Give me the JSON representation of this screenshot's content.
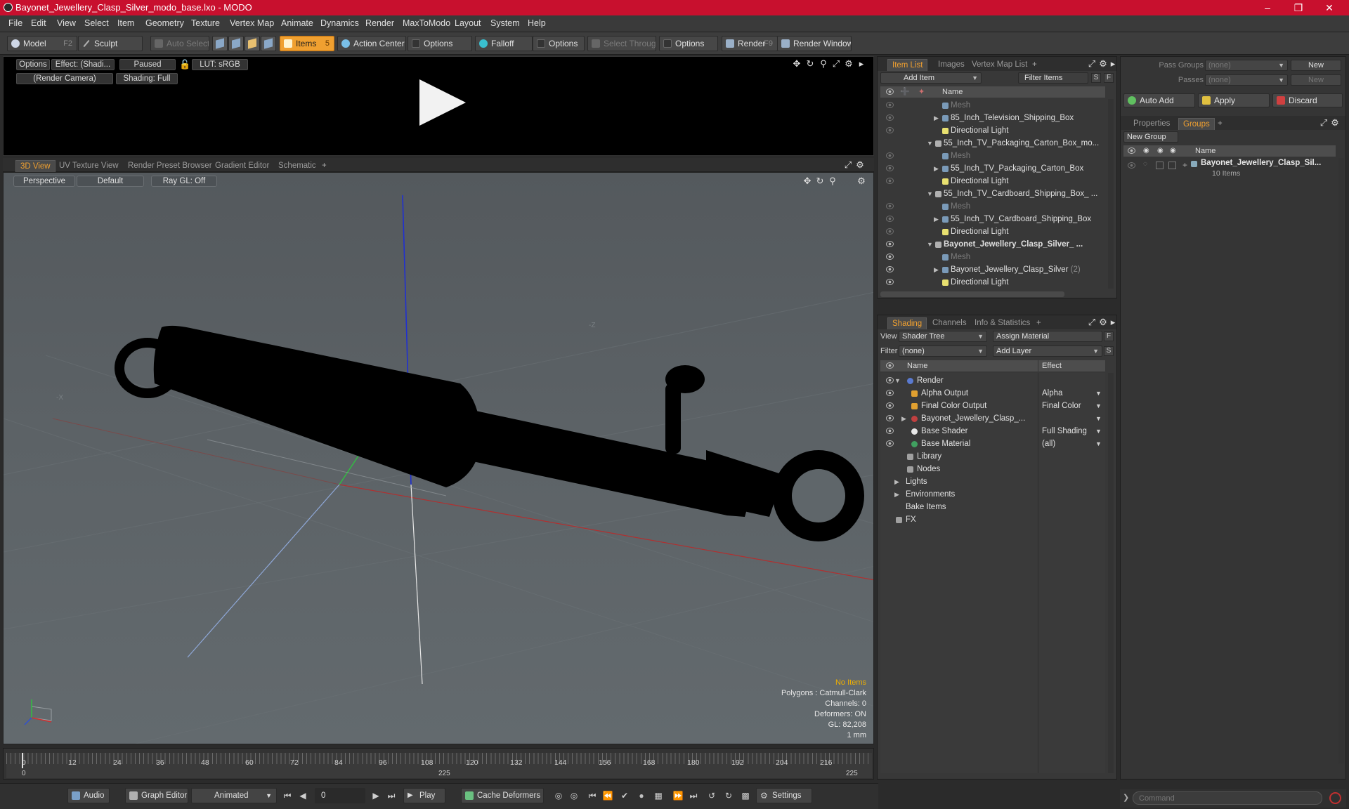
{
  "window": {
    "title": "Bayonet_Jewellery_Clasp_Silver_modo_base.lxo - MODO"
  },
  "menu": [
    "File",
    "Edit",
    "View",
    "Select",
    "Item",
    "Geometry",
    "Texture",
    "Vertex Map",
    "Animate",
    "Dynamics",
    "Render",
    "MaxToModo",
    "Layout",
    "System",
    "Help"
  ],
  "toolbar": {
    "model": "Model",
    "model_key": "F2",
    "sculpt": "Sculpt",
    "auto_select": "Auto Select",
    "items": "Items",
    "items_key": "5",
    "action_center": "Action Center",
    "options1": "Options",
    "falloff": "Falloff",
    "options2": "Options",
    "select_through": "Select Through",
    "options3": "Options",
    "render": "Render",
    "render_key": "F9",
    "render_window": "Render Window"
  },
  "preview": {
    "options": "Options",
    "effect": "Effect: (Shadi...",
    "paused": "Paused",
    "lut": "LUT: sRGB",
    "camera": "(Render Camera)",
    "shading": "Shading: Full"
  },
  "viewport_tabs": [
    "3D View",
    "UV Texture View",
    "Render Preset Browser",
    "Gradient Editor",
    "Schematic"
  ],
  "viewport": {
    "perspective": "Perspective",
    "default": "Default",
    "raygl": "Ray GL: Off",
    "info": {
      "no_items": "No Items",
      "polygons": "Polygons : Catmull-Clark",
      "channels": "Channels: 0",
      "deformers": "Deformers: ON",
      "gl": "GL: 82,208",
      "unit": "1 mm"
    }
  },
  "timeline": {
    "ticks": [
      "0",
      "12",
      "24",
      "36",
      "48",
      "60",
      "72",
      "84",
      "96",
      "108",
      "120",
      "132",
      "144",
      "156",
      "168",
      "180",
      "192",
      "204",
      "216"
    ],
    "lower": [
      "0",
      "225",
      "225"
    ]
  },
  "bottombar": {
    "audio": "Audio",
    "graph_editor": "Graph Editor",
    "animated": "Animated",
    "frame": "0",
    "play": "Play",
    "cache_deformers": "Cache Deformers",
    "settings": "Settings"
  },
  "item_list": {
    "tabs": [
      "Item List",
      "Images",
      "Vertex Map List"
    ],
    "add_item": "Add Item",
    "filter_items": "Filter Items",
    "col_name": "Name",
    "rows": [
      {
        "label": "Mesh",
        "kind": "mesh",
        "indent": 2,
        "expander": "",
        "eye": "dim"
      },
      {
        "label": "85_Inch_Television_Shipping_Box",
        "kind": "mesh",
        "indent": 2,
        "expander": "▶",
        "eye": "dim"
      },
      {
        "label": "Directional Light",
        "kind": "light",
        "indent": 2,
        "expander": "",
        "eye": "dim"
      },
      {
        "label": "55_Inch_TV_Packaging_Carton_Box_mo...",
        "kind": "scene",
        "indent": 1,
        "expander": "▼",
        "eye": "none"
      },
      {
        "label": "Mesh",
        "kind": "mesh",
        "indent": 2,
        "expander": "",
        "eye": "dim"
      },
      {
        "label": "55_Inch_TV_Packaging_Carton_Box",
        "kind": "mesh",
        "indent": 2,
        "expander": "▶",
        "eye": "dim"
      },
      {
        "label": "Directional Light",
        "kind": "light",
        "indent": 2,
        "expander": "",
        "eye": "dim"
      },
      {
        "label": "55_Inch_TV_Cardboard_Shipping_Box_ ...",
        "kind": "scene",
        "indent": 1,
        "expander": "▼",
        "eye": "none"
      },
      {
        "label": "Mesh",
        "kind": "mesh",
        "indent": 2,
        "expander": "",
        "eye": "dim"
      },
      {
        "label": "55_Inch_TV_Cardboard_Shipping_Box",
        "kind": "mesh",
        "indent": 2,
        "expander": "▶",
        "eye": "dim"
      },
      {
        "label": "Directional Light",
        "kind": "light",
        "indent": 2,
        "expander": "",
        "eye": "dim"
      },
      {
        "label": "Bayonet_Jewellery_Clasp_Silver_ ...",
        "kind": "scene",
        "indent": 1,
        "expander": "▼",
        "eye": "on",
        "bold": true
      },
      {
        "label": "Mesh",
        "kind": "mesh",
        "indent": 2,
        "expander": "",
        "eye": "on"
      },
      {
        "label": "Bayonet_Jewellery_Clasp_Silver",
        "suffix": "(2)",
        "kind": "mesh",
        "indent": 2,
        "expander": "▶",
        "eye": "on"
      },
      {
        "label": "Directional Light",
        "kind": "light",
        "indent": 2,
        "expander": "",
        "eye": "on"
      }
    ]
  },
  "shading": {
    "tabs": [
      "Shading",
      "Channels",
      "Info & Statistics"
    ],
    "view_label": "View",
    "view_value": "Shader Tree",
    "assign_material": "Assign Material",
    "filter_label": "Filter",
    "filter_value": "(none)",
    "add_layer": "Add Layer",
    "col_name": "Name",
    "col_effect": "Effect",
    "rows": [
      {
        "label": "Render",
        "effect": "",
        "indent": 1,
        "expander": "▼",
        "icon": "render",
        "eye": true
      },
      {
        "label": "Alpha Output",
        "effect": "Alpha",
        "indent": 2,
        "expander": "",
        "icon": "output",
        "eye": true
      },
      {
        "label": "Final Color Output",
        "effect": "Final Color",
        "indent": 2,
        "expander": "",
        "icon": "output",
        "eye": true
      },
      {
        "label": "Bayonet_Jewellery_Clasp_...",
        "effect": "",
        "indent": 2,
        "expander": "▶",
        "icon": "material-group",
        "eye": true
      },
      {
        "label": "Base Shader",
        "effect": "Full Shading",
        "indent": 2,
        "expander": "",
        "icon": "shader",
        "eye": true
      },
      {
        "label": "Base Material",
        "effect": "(all)",
        "indent": 2,
        "expander": "",
        "icon": "material",
        "eye": true
      },
      {
        "label": "Library",
        "effect": "",
        "indent": 1,
        "expander": "",
        "icon": "folder",
        "eye": false
      },
      {
        "label": "Nodes",
        "effect": "",
        "indent": 1,
        "expander": "",
        "icon": "folder",
        "eye": false
      },
      {
        "label": "Lights",
        "effect": "",
        "indent": 0,
        "expander": "▶",
        "icon": "",
        "eye": false
      },
      {
        "label": "Environments",
        "effect": "",
        "indent": 0,
        "expander": "▶",
        "icon": "",
        "eye": false
      },
      {
        "label": "Bake Items",
        "effect": "",
        "indent": 0,
        "expander": "",
        "icon": "",
        "eye": false
      },
      {
        "label": "FX",
        "effect": "",
        "indent": 0,
        "expander": "",
        "icon": "fx",
        "eye": false
      }
    ]
  },
  "groups": {
    "pass_groups_label": "Pass Groups",
    "pass_groups_value": "(none)",
    "new1": "New",
    "passes_label": "Passes",
    "passes_value": "(none)",
    "new2": "New",
    "auto_add": "Auto Add",
    "apply": "Apply",
    "discard": "Discard",
    "tabs": [
      "Properties",
      "Groups"
    ],
    "new_group": "New Group",
    "col_name": "Name",
    "group_name": "Bayonet_Jewellery_Clasp_Sil...",
    "group_count": "10 Items"
  },
  "command": {
    "placeholder": "Command"
  }
}
